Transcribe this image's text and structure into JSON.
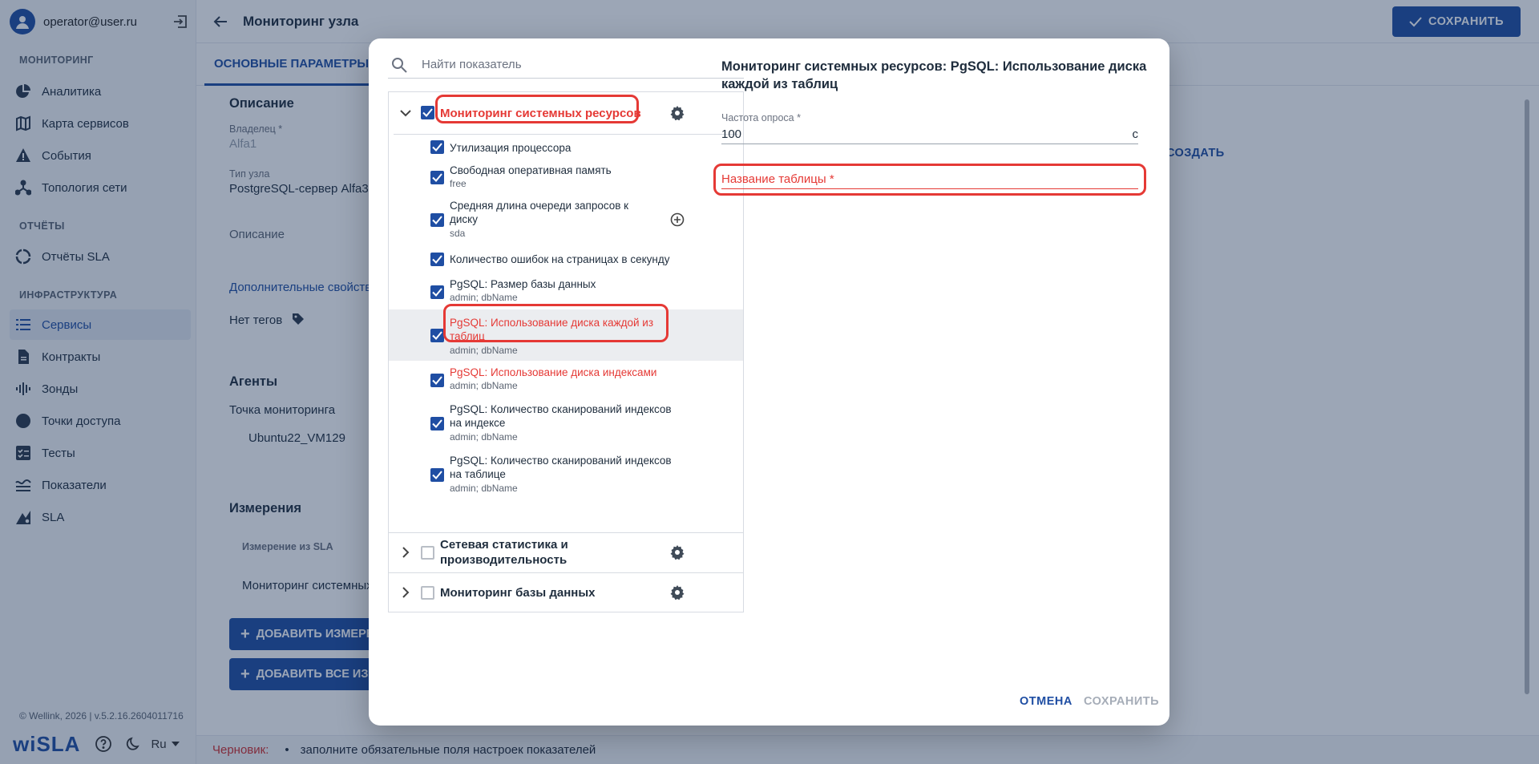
{
  "user": {
    "email": "operator@user.ru"
  },
  "sidebar": {
    "sections": [
      {
        "title": "МОНИТОРИНГ"
      },
      {
        "title": "ОТЧЁТЫ"
      },
      {
        "title": "ИНФРАСТРУКТУРА"
      }
    ],
    "items": [
      {
        "label": "Аналитика",
        "icon": "pie-chart-icon"
      },
      {
        "label": "Карта сервисов",
        "icon": "map-icon"
      },
      {
        "label": "События",
        "icon": "warning-icon"
      },
      {
        "label": "Топология сети",
        "icon": "topology-icon"
      },
      {
        "label": "Отчёты SLA",
        "icon": "report-icon"
      },
      {
        "label": "Сервисы",
        "icon": "list-icon",
        "active": true
      },
      {
        "label": "Контракты",
        "icon": "document-icon"
      },
      {
        "label": "Зонды",
        "icon": "waveform-icon"
      },
      {
        "label": "Точки доступа",
        "icon": "circle-icon"
      },
      {
        "label": "Тесты",
        "icon": "checklist-icon"
      },
      {
        "label": "Показатели",
        "icon": "metrics-icon"
      },
      {
        "label": "SLA",
        "icon": "sla-icon"
      }
    ],
    "copyright": "© Wellink, 2026 | v.5.2.16.2604011716",
    "logo": "wiSLA",
    "language": "Ru"
  },
  "header": {
    "title": "Мониторинг узла",
    "save_label": "СОХРАНИТЬ"
  },
  "tabs": {
    "main": "ОСНОВНЫЕ ПАРАМЕТРЫ"
  },
  "page": {
    "description_title": "Описание",
    "owner_label": "Владелец *",
    "owner_value": "Alfa1",
    "node_type_label": "Тип узла",
    "node_type_value": "PostgreSQL-сервер Alfa3",
    "description_placeholder": "Описание",
    "extra_props_link": "Дополнительные свойства",
    "no_tags": "Нет тегов",
    "agents_title": "Агенты",
    "monitoring_point_label": "Точка мониторинга",
    "agent_value": "Ubuntu22_VM129",
    "measurements_title": "Измерения",
    "measurement_col": "Измерение из SLA",
    "measurement_row": "Мониторинг системных",
    "add_measurement": "ДОБАВИТЬ ИЗМЕРЕНИЕ",
    "add_all": "ДОБАВИТЬ ВСЕ ИЗМЕРЕНИЯ",
    "create_link": "СОЗДАТЬ"
  },
  "status": {
    "draft_label": "Черновик:",
    "draft_message": "заполните обязательные поля настроек показателей"
  },
  "modal": {
    "search_placeholder": "Найти показатель",
    "groups": [
      {
        "title": "Мониторинг системных ресурсов",
        "checked": true,
        "expanded": true
      },
      {
        "title": "Сетевая статистика и производительность",
        "checked": false,
        "expanded": false
      },
      {
        "title": "Мониторинг базы данных",
        "checked": false,
        "expanded": false
      }
    ],
    "indicators": [
      {
        "title": "Утилизация процессора",
        "sub": "",
        "checked": true
      },
      {
        "title": "Свободная оперативная память",
        "sub": "free",
        "checked": true
      },
      {
        "title": "Средняя длина очереди запросов к диску",
        "sub": "sda",
        "checked": true
      },
      {
        "title": "Количество ошибок на страницах в секунду",
        "sub": "",
        "checked": true
      },
      {
        "title": "PgSQL: Размер базы данных",
        "sub": "admin; dbName",
        "checked": true
      },
      {
        "title": "PgSQL: Использование диска каждой из таблиц",
        "sub": "admin; dbName",
        "checked": true,
        "error": true,
        "selected": true
      },
      {
        "title": "PgSQL: Использование диска индексами",
        "sub": "admin; dbName",
        "checked": true,
        "error": true
      },
      {
        "title": "PgSQL: Количество сканирований индексов на индексе",
        "sub": "admin; dbName",
        "checked": true
      },
      {
        "title": "PgSQL: Количество сканирований индексов на таблице",
        "sub": "admin; dbName",
        "checked": true
      }
    ],
    "detail": {
      "title": "Мониторинг системных ресурсов: PgSQL: Использование диска каждой из таблиц",
      "frequency_label": "Частота опроса *",
      "frequency_value": "100",
      "frequency_unit": "с",
      "table_name_label": "Название таблицы *"
    },
    "cancel_label": "ОТМЕНА",
    "save_label": "СОХРАНИТЬ"
  },
  "colors": {
    "accent": "#1f4ea3",
    "error": "#e53935",
    "overlay": "#142a50"
  }
}
